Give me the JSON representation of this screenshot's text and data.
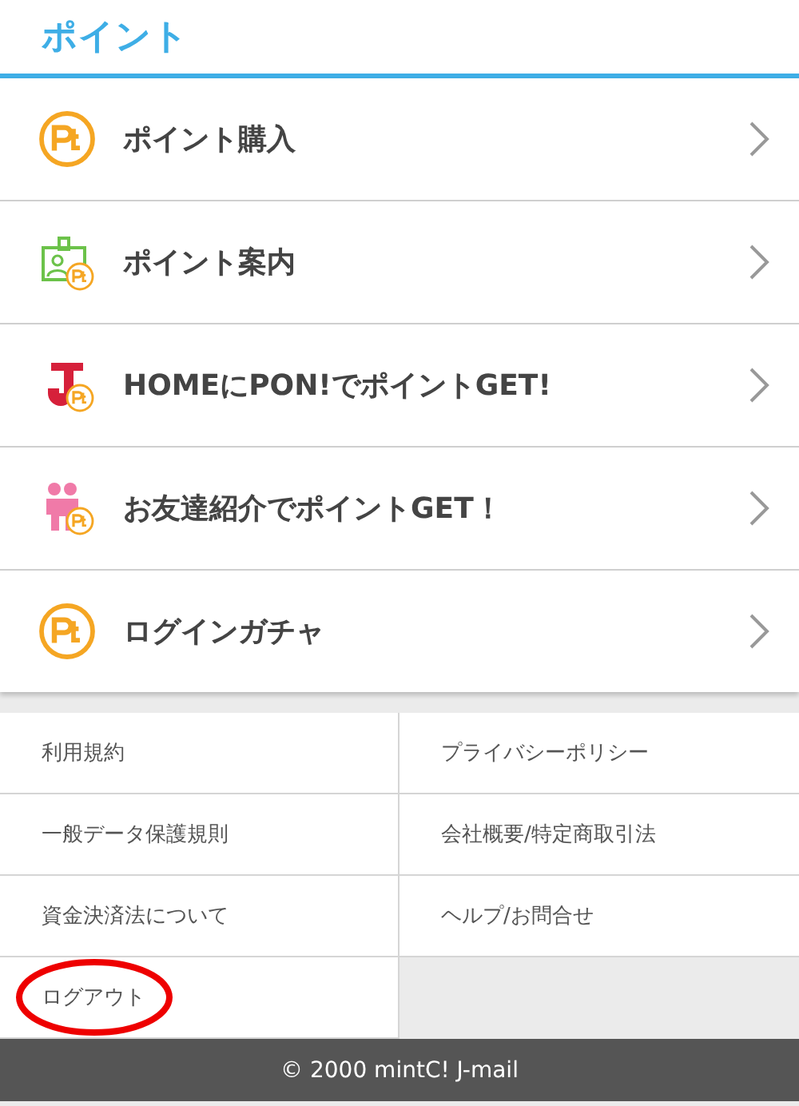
{
  "header": {
    "title": "ポイント"
  },
  "menu": [
    {
      "kind": "coin",
      "label": "ポイント購入"
    },
    {
      "kind": "badge",
      "label": "ポイント案内"
    },
    {
      "kind": "letter",
      "label": "HOMEにPON!でポイントGET!"
    },
    {
      "kind": "friends",
      "label": "お友達紹介でポイントGET！"
    },
    {
      "kind": "coin",
      "label": "ログインガチャ"
    }
  ],
  "links": [
    {
      "label": "利用規約",
      "highlighted": false
    },
    {
      "label": "プライバシーポリシー",
      "highlighted": false
    },
    {
      "label": "一般データ保護規則",
      "highlighted": false
    },
    {
      "label": "会社概要/特定商取引法",
      "highlighted": false
    },
    {
      "label": "資金決済法について",
      "highlighted": false
    },
    {
      "label": "ヘルプ/お問合せ",
      "highlighted": false
    },
    {
      "label": "ログアウト",
      "highlighted": true
    }
  ],
  "footer": {
    "copyright": "© 2000 mintC! J-mail"
  }
}
